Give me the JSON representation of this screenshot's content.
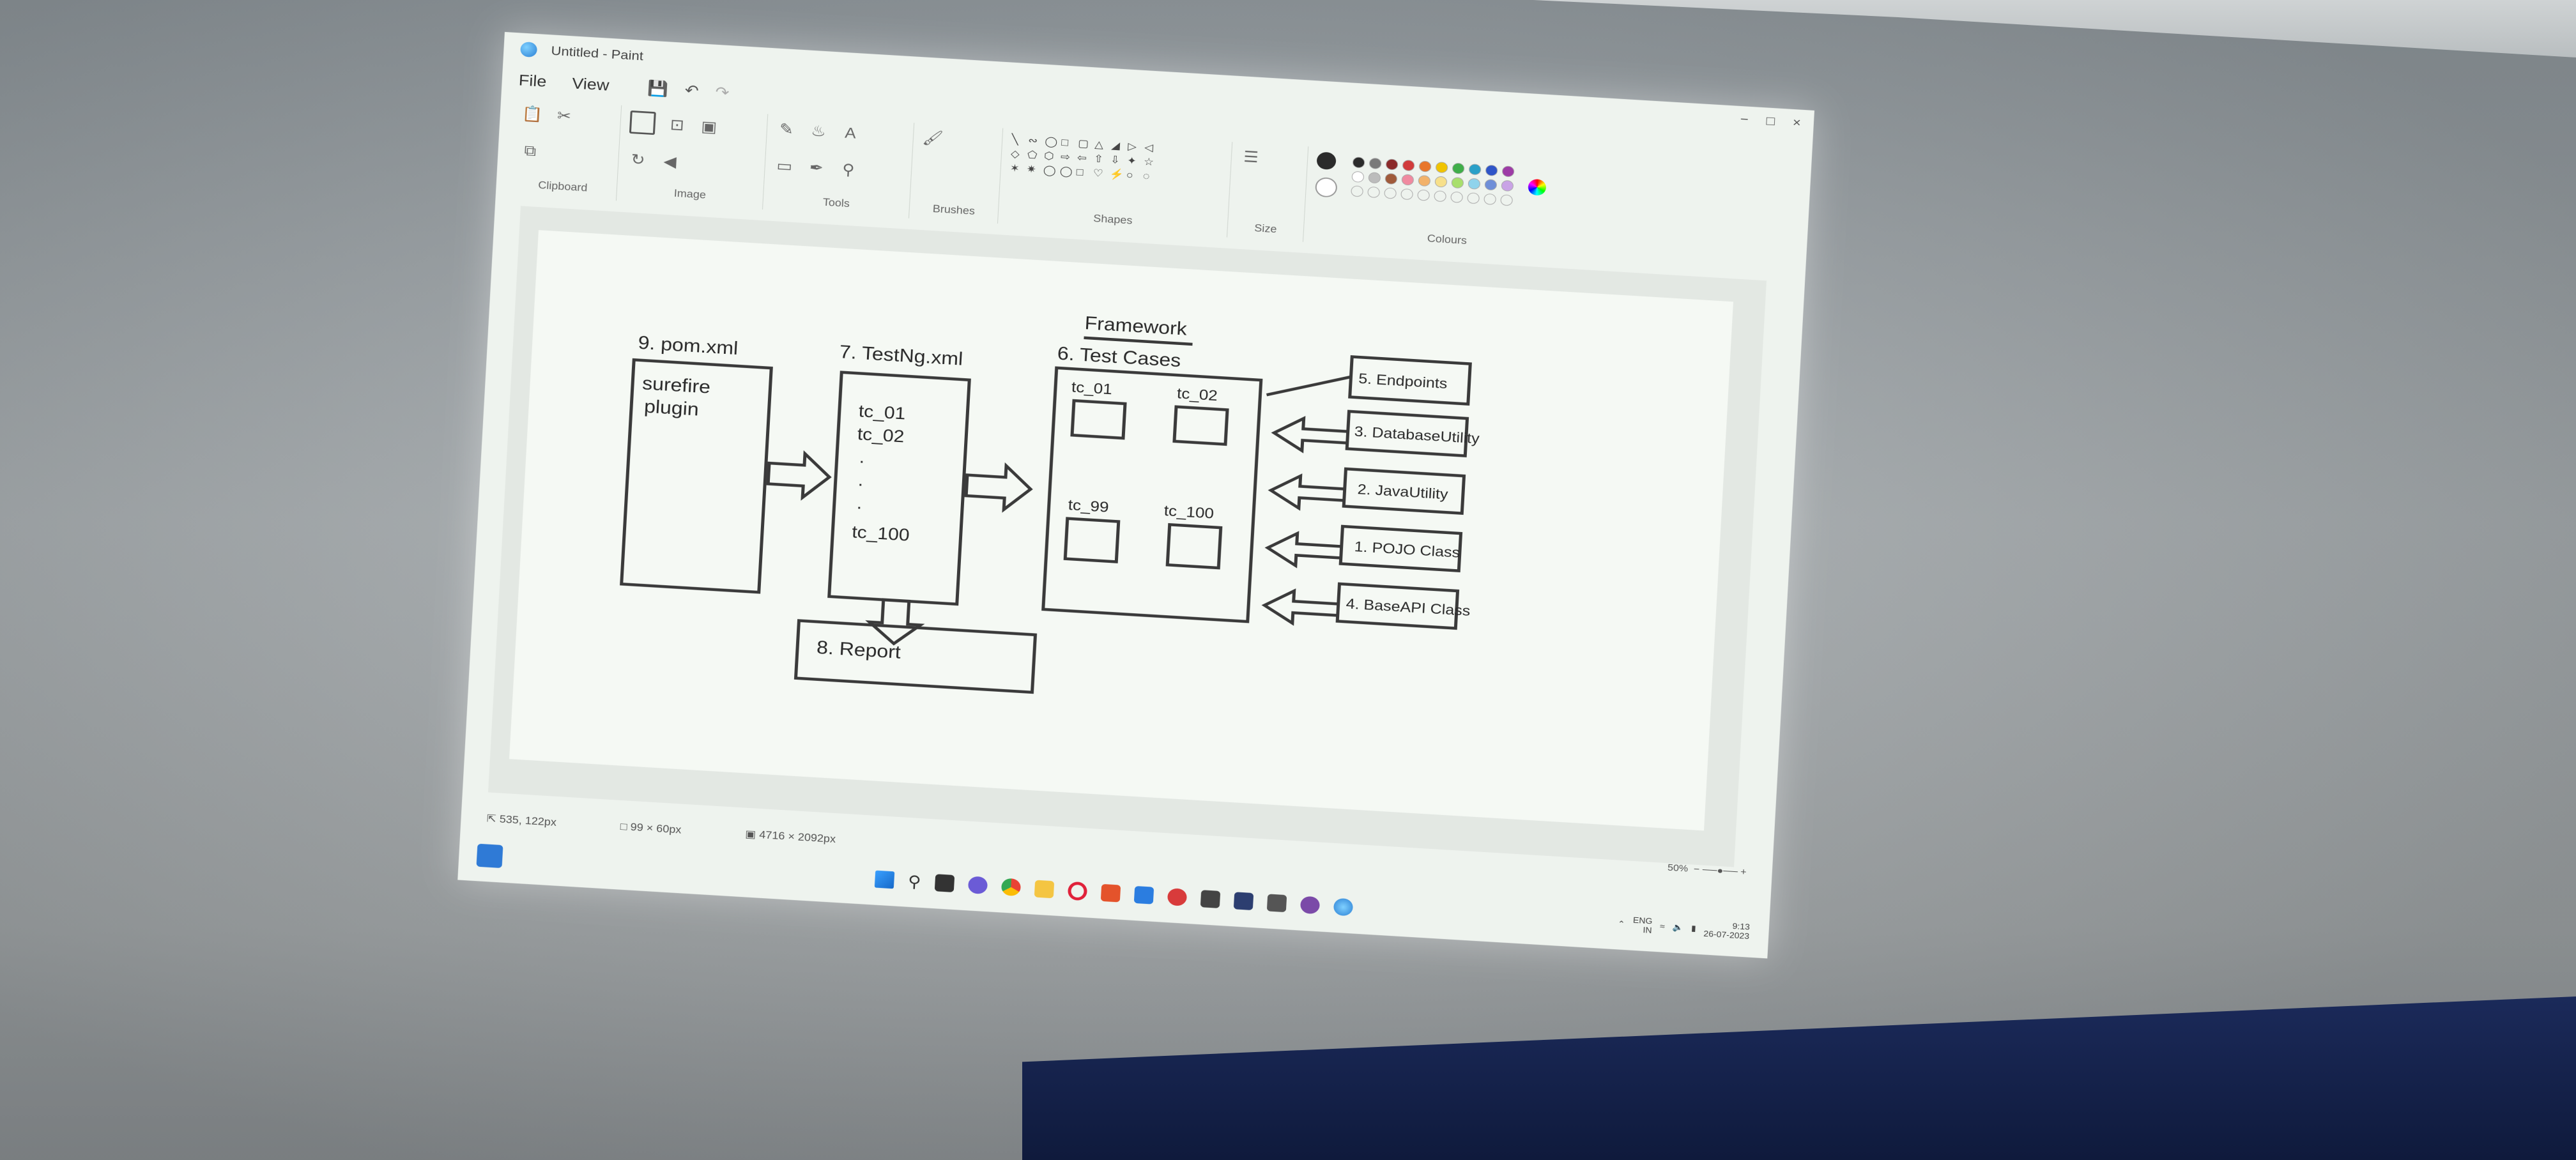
{
  "window": {
    "title": "Untitled - Paint",
    "controls": [
      "−",
      "□",
      "×"
    ]
  },
  "menu": {
    "file": "File",
    "view": "View"
  },
  "ribbon": {
    "groups": [
      "Clipboard",
      "Image",
      "Tools",
      "Brushes",
      "Shapes",
      "Size",
      "Colours"
    ],
    "text_tool": "A"
  },
  "palette": {
    "row1": [
      "#2b2b2b",
      "#7a7a7a",
      "#8b2a2a",
      "#d13b3b",
      "#e8762b",
      "#f0c400",
      "#3fae49",
      "#2aa0c8",
      "#2f55c8",
      "#9d3ba6"
    ],
    "row2": [
      "#ffffff",
      "#bcbcbc",
      "#a05a3a",
      "#f08aa0",
      "#f2b26a",
      "#f7e08a",
      "#a8df6c",
      "#8fd3ec",
      "#6f8fd8",
      "#c9a3e6"
    ],
    "primary": "#2b2b2b",
    "secondary": "#ffffff"
  },
  "diagram": {
    "framework": "Framework",
    "pom_title": "9. pom.xml",
    "pom_line1": "surefire",
    "pom_line2": "plugin",
    "testng_title": "7. TestNg.xml",
    "testng_items": [
      "tc_01",
      "tc_02",
      ".",
      ".",
      ".",
      "tc_100"
    ],
    "testcases_title": "6. Test Cases",
    "tc_labels": [
      "tc_01",
      "tc_02",
      "tc_99",
      "tc_100"
    ],
    "report": "8. Report",
    "right_boxes": [
      "5. Endpoints",
      "3. DatabaseUtility",
      "2. JavaUtility",
      "1. POJO Class",
      "4. BaseAPI Class"
    ]
  },
  "status": {
    "cursor": "535, 122px",
    "selection": "99 × 60px",
    "canvas_size": "4716 × 2092px",
    "zoom": "50%"
  },
  "tray": {
    "lang": "ENG",
    "region": "IN",
    "time": "9:13",
    "date": "26-07-2023"
  }
}
